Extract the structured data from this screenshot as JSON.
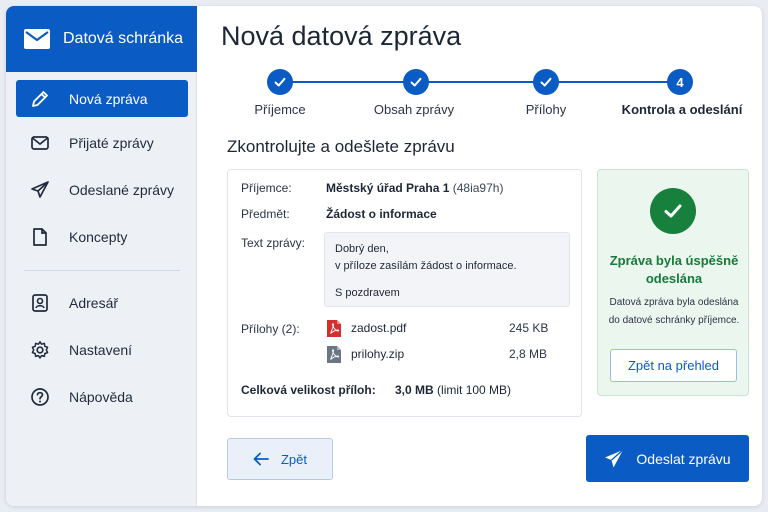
{
  "app": {
    "title": "Datová schránka",
    "icon": "envelope-icon",
    "brand_color": "#0b5bc4"
  },
  "sidebar": {
    "items": [
      {
        "label": "Nová zpráva",
        "icon": "pencil-icon",
        "active": true
      },
      {
        "label": "Přijaté zprávy",
        "icon": "inbox-icon",
        "active": false
      },
      {
        "label": "Odeslané zprávy",
        "icon": "send-icon",
        "active": false
      },
      {
        "label": "Koncepty",
        "icon": "document-icon",
        "active": false
      },
      {
        "label": "Adresář",
        "icon": "contact-book-icon",
        "active": false
      },
      {
        "label": "Nastavení",
        "icon": "gear-icon",
        "active": false
      },
      {
        "label": "Nápověda",
        "icon": "help-icon",
        "active": false
      }
    ]
  },
  "main": {
    "title": "Nová datová zpráva",
    "steps": [
      {
        "label": "Příjemce",
        "state": "done"
      },
      {
        "label": "Obsah zprávy",
        "state": "done"
      },
      {
        "label": "Přílohy",
        "state": "done"
      },
      {
        "label": "Kontrola a odeslání",
        "state": "current",
        "number": "4"
      }
    ],
    "section_heading": "Zkontrolujte a odešlete zprávu"
  },
  "summary": {
    "recipient_label": "Příjemce:",
    "recipient_name": "Městský úřad Praha 1",
    "recipient_id": "(48ia97h)",
    "subject_label": "Předmět:",
    "subject_value": "Žádost o informace",
    "message_label": "Text zprávy:",
    "message_lines": [
      "Dobrý den,",
      "v příloze zasílám žádost o informace.",
      "S pozdravem"
    ],
    "attachments_label": "Přílohy (2):",
    "attachments": [
      {
        "name": "zadost.pdf",
        "size": "245 KB",
        "icon": "pdf-file-icon",
        "color": "#d32f2f"
      },
      {
        "name": "prilohy.zip",
        "size": "2,8 MB",
        "icon": "zip-file-icon",
        "color": "#6b7684"
      }
    ],
    "total_label": "Celková velikost příloh:",
    "total_value": "3,0 MB",
    "total_limit": "(limit 100 MB)"
  },
  "success": {
    "icon": "check-circle-icon",
    "title": "Zpráva byla úspěšně odeslána",
    "text": "Datová zpráva byla odeslána do datové schránky příjemce.",
    "button_label": "Zpět na přehled",
    "color": "#16803c"
  },
  "actions": {
    "back_label": "Zpět",
    "send_label": "Odeslat zprávu"
  }
}
